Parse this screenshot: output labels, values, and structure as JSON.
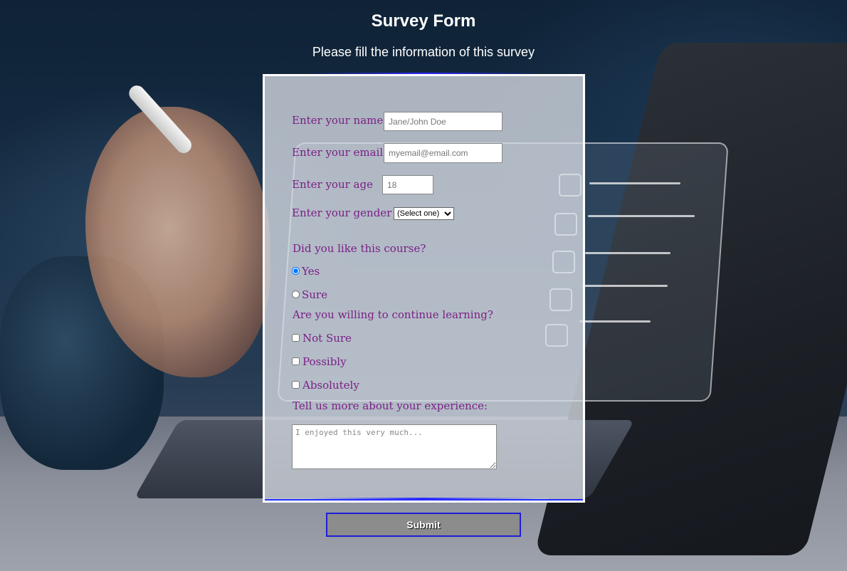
{
  "page": {
    "title": "Survey Form",
    "description": "Please fill the information of this survey"
  },
  "form": {
    "name": {
      "label": "Enter your name",
      "placeholder": "Jane/John Doe",
      "value": ""
    },
    "email": {
      "label": "Enter your email",
      "placeholder": "myemail@email.com",
      "value": ""
    },
    "age": {
      "label": "Enter your age",
      "placeholder": "18",
      "value": ""
    },
    "gender": {
      "label": "Enter your gender",
      "selected": "(Select one)"
    },
    "course": {
      "question": "Did you like this course?",
      "options": [
        {
          "label": "Yes",
          "checked": true
        },
        {
          "label": "Sure",
          "checked": false
        }
      ]
    },
    "continue_learning": {
      "question": "Are you willing to continue learning?",
      "options": [
        {
          "label": "Not Sure",
          "checked": false
        },
        {
          "label": "Possibly",
          "checked": false
        },
        {
          "label": "Absolutely",
          "checked": false
        }
      ]
    },
    "experience": {
      "label": "Tell us more about your experience:",
      "placeholder": "I enjoyed this very much..."
    },
    "submit_label": "Submit"
  },
  "colors": {
    "label_text": "#7b1f86",
    "accent_border": "#1f1fd6",
    "submit_bg": "#8c8c8c"
  }
}
